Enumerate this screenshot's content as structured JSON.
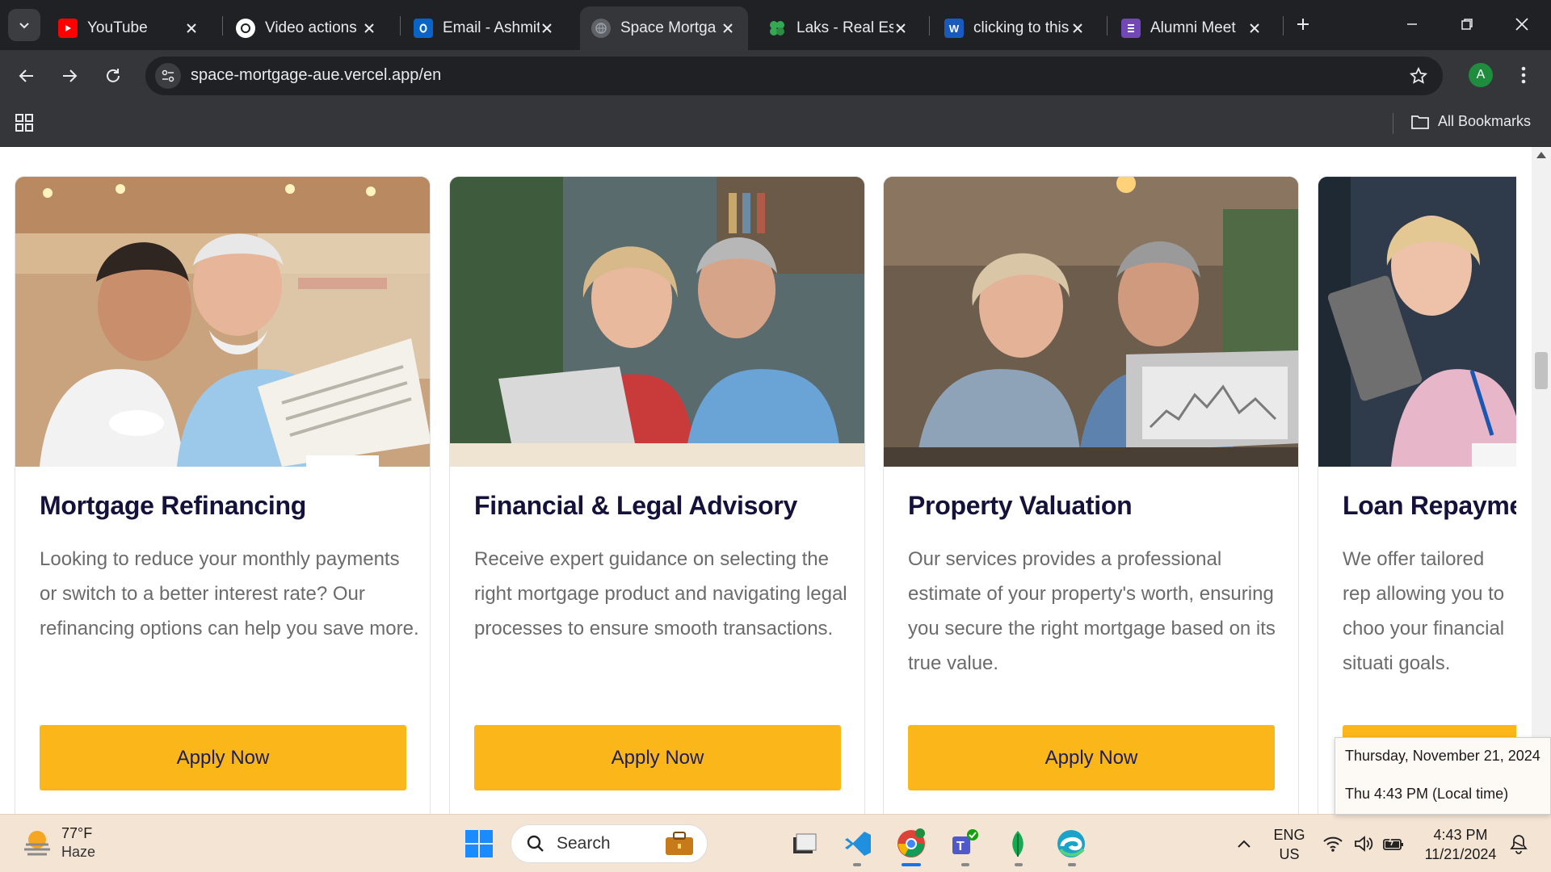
{
  "browser": {
    "tabs": [
      {
        "label": "YouTube",
        "icon": "youtube-icon",
        "active": false
      },
      {
        "label": "Video actions",
        "icon": "chatgpt-icon",
        "active": false
      },
      {
        "label": "Email - Ashmit",
        "icon": "outlook-icon",
        "active": false
      },
      {
        "label": "Space Mortga",
        "icon": "globe-icon",
        "active": true
      },
      {
        "label": "Laks - Real Est",
        "icon": "clover-icon",
        "active": false
      },
      {
        "label": "clicking to this",
        "icon": "word-icon",
        "active": false
      },
      {
        "label": "Alumni Meet",
        "icon": "forms-icon",
        "active": false
      }
    ],
    "url": "space-mortgage-aue.vercel.app/en",
    "profile_initial": "A",
    "bookmarks_label": "All Bookmarks"
  },
  "services": [
    {
      "title": "Mortgage Refinancing",
      "description": "Looking to reduce your monthly payments or switch to a better interest rate? Our refinancing options can help you save more.",
      "button": "Apply Now"
    },
    {
      "title": "Financial & Legal Advisory",
      "description": "Receive expert guidance on selecting the right mortgage product and navigating legal processes to ensure smooth transactions.",
      "button": "Apply Now"
    },
    {
      "title": "Property Valuation",
      "description": "Our services provides a professional estimate of your property's worth, ensuring you secure the right mortgage based on its true value.",
      "button": "Apply Now"
    },
    {
      "title": "Loan Repayme",
      "description": "We offer tailored rep allowing you to choo your financial situati goals."
    }
  ],
  "taskbar": {
    "weather_temp": "77°F",
    "weather_cond": "Haze",
    "search_label": "Search",
    "lang_line1": "ENG",
    "lang_line2": "US",
    "time": "4:43 PM",
    "date": "11/21/2024"
  },
  "clock_popup": {
    "date_full": "Thursday, November 21, 2024",
    "local_time": "Thu 4:43 PM (Local time)"
  },
  "colors": {
    "accent_button": "#fbb719",
    "title_text": "#14123a",
    "body_text": "#6b6b6b"
  }
}
